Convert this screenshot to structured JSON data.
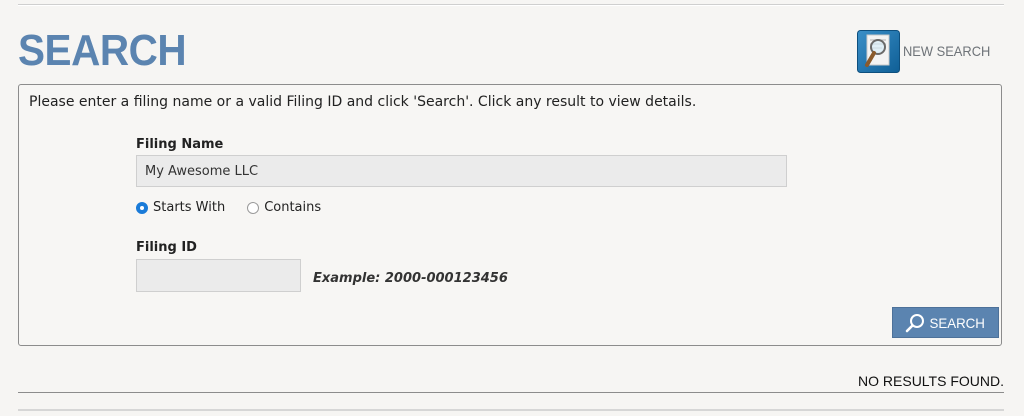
{
  "header": {
    "title": "SEARCH",
    "new_search_label": "NEW SEARCH",
    "new_search_icon": "magnifier-document-icon"
  },
  "form": {
    "instructions": "Please enter a filing name or a valid Filing ID and click 'Search'. Click any result to view details.",
    "filing_name": {
      "label": "Filing Name",
      "value": "My Awesome LLC"
    },
    "match_options": [
      {
        "label": "Starts With",
        "selected": true
      },
      {
        "label": "Contains",
        "selected": false
      }
    ],
    "filing_id": {
      "label": "Filing ID",
      "value": "",
      "example": "Example: 2000-000123456"
    },
    "search_button": {
      "label": "SEARCH",
      "icon": "search-icon"
    }
  },
  "results": {
    "status": "NO RESULTS FOUND."
  },
  "colors": {
    "accent": "#5b84b0",
    "background": "#f6f5f3",
    "radio_selected": "#1a7bd8",
    "input_bg": "#ebebeb"
  }
}
